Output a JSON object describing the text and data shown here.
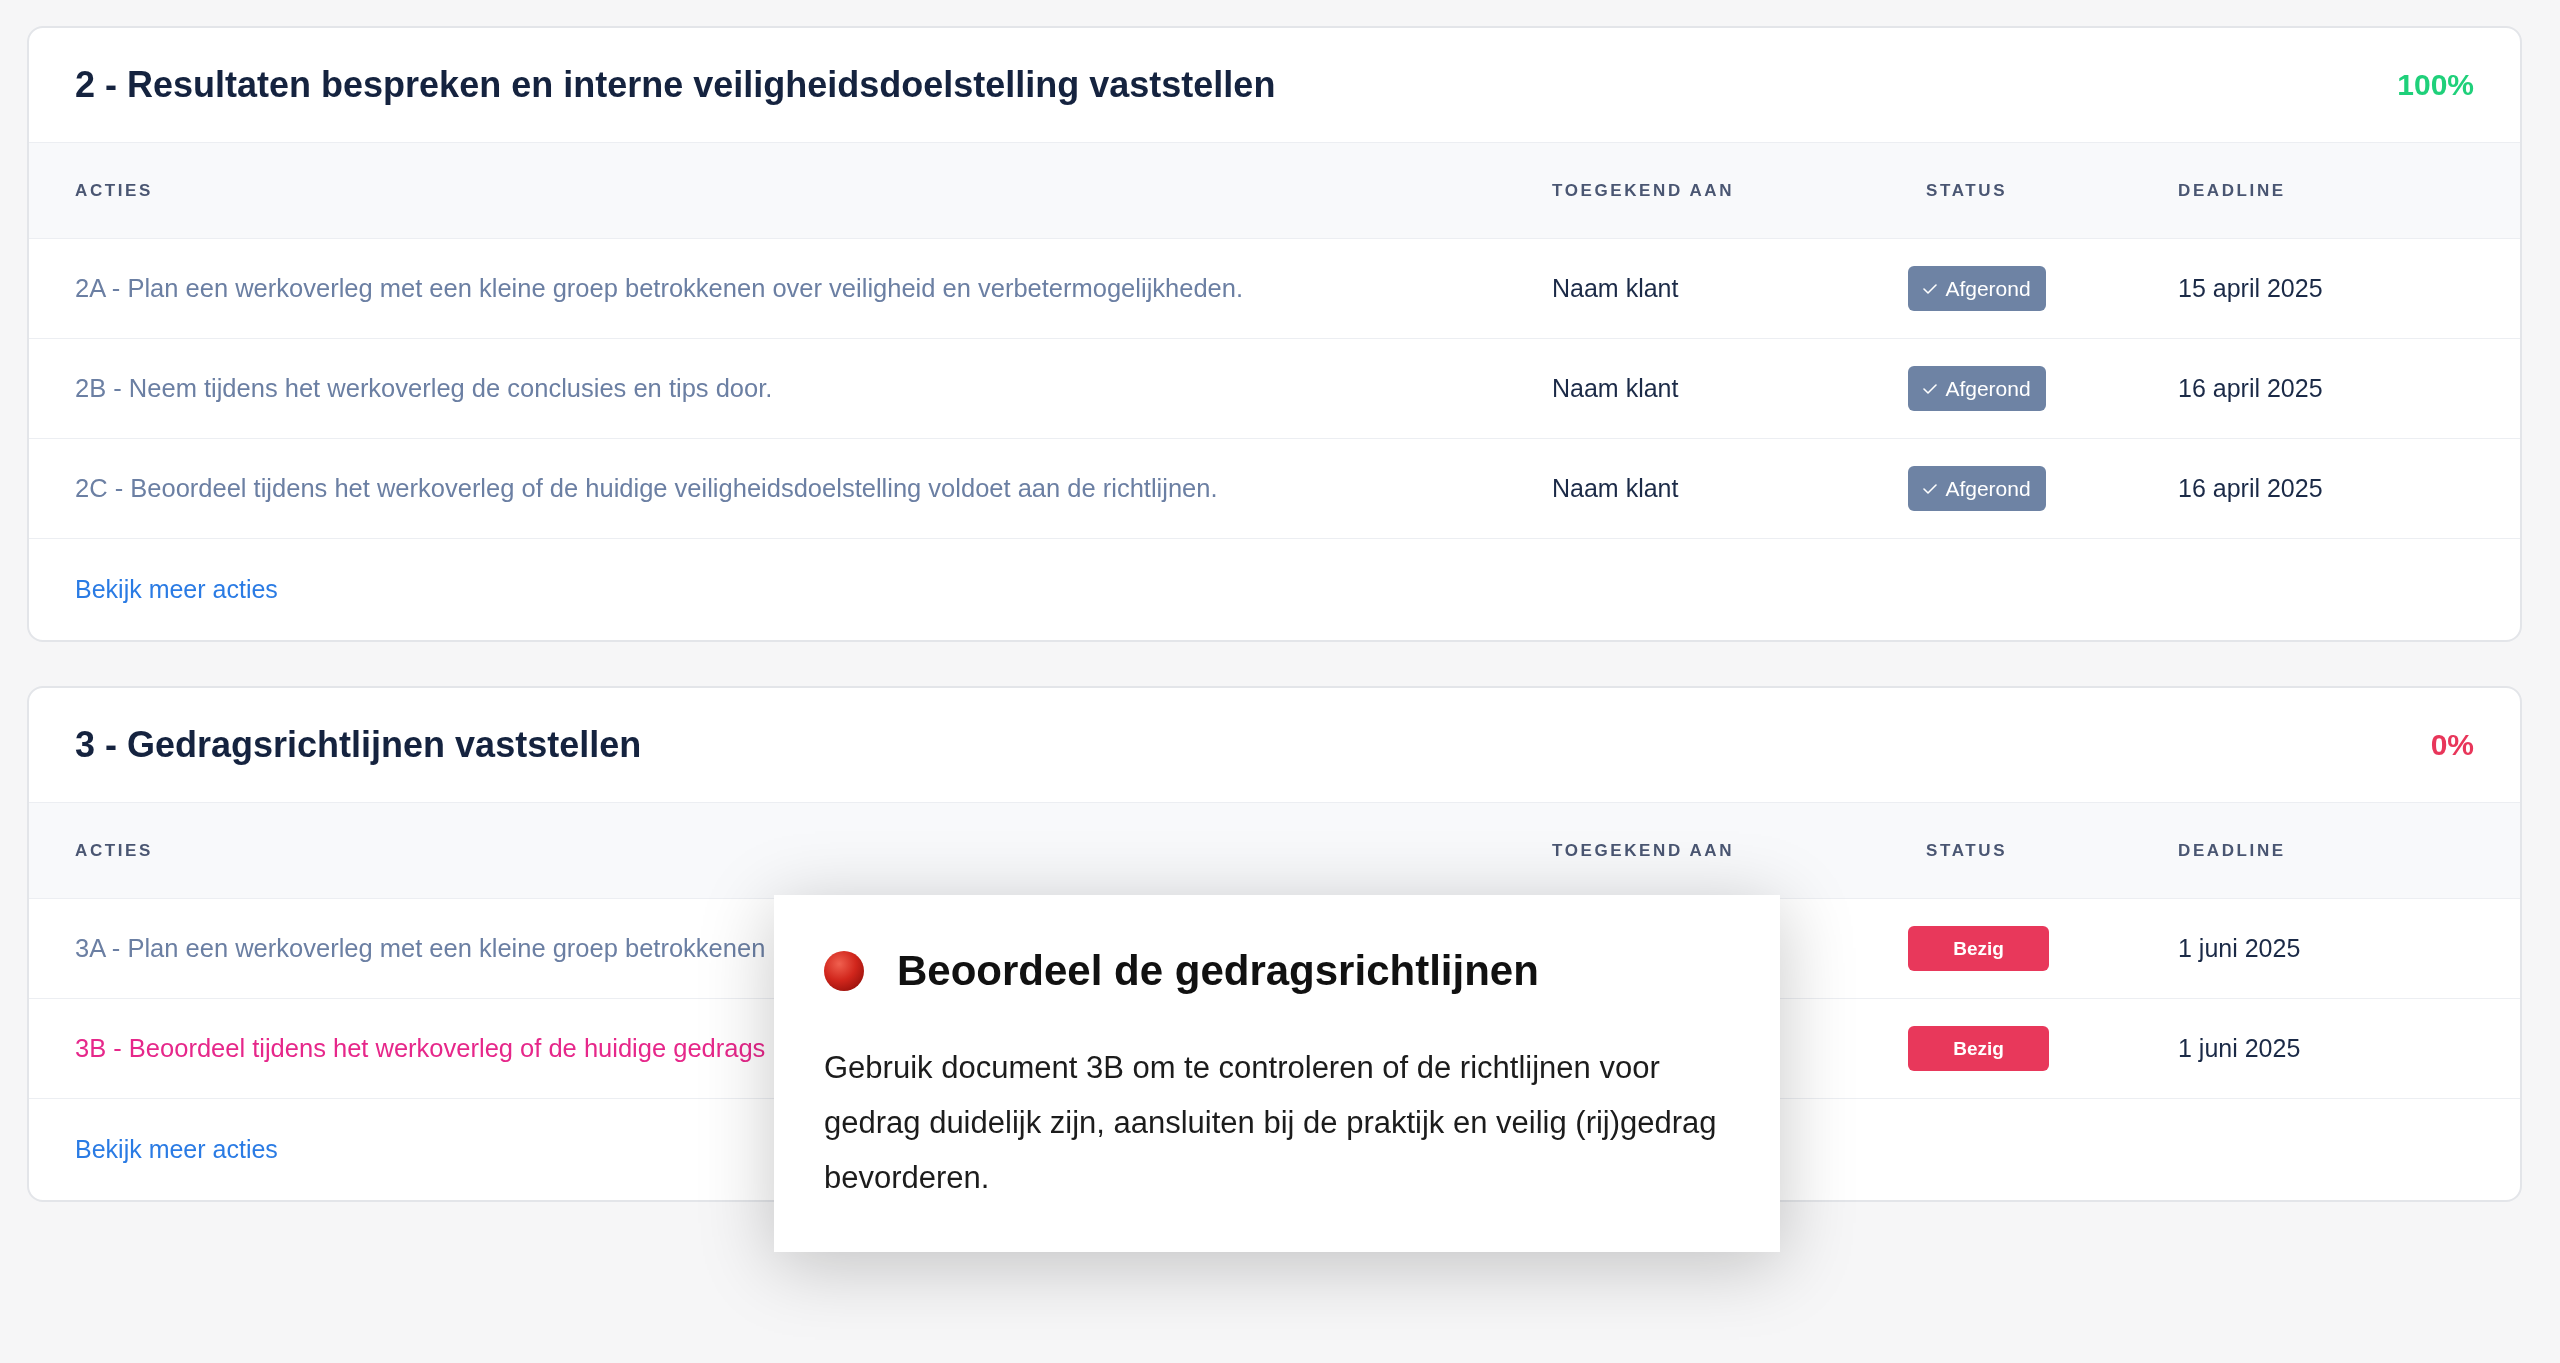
{
  "sections": [
    {
      "title": "2 - Resultaten bespreken en interne veiligheidsdoelstelling vaststellen",
      "progress": "100%",
      "complete": true,
      "columns": [
        "ACTIES",
        "TOEGEKEND AAN",
        "STATUS",
        "DEADLINE"
      ],
      "rows": [
        {
          "action": "2A - Plan een werkoverleg met een kleine groep betrokkenen over veiligheid en verbetermogelijkheden.",
          "selected": false,
          "assignee": "Naam klant",
          "status": {
            "kind": "done",
            "label": "Afgerond"
          },
          "deadline": "15 april 2025"
        },
        {
          "action": "2B - Neem tijdens het werkoverleg de conclusies en tips door.",
          "selected": false,
          "assignee": "Naam klant",
          "status": {
            "kind": "done",
            "label": "Afgerond"
          },
          "deadline": "16 april 2025"
        },
        {
          "action": "2C - Beoordeel tijdens het werkoverleg of de huidige veiligheidsdoelstelling voldoet aan de richtlijnen.",
          "selected": false,
          "assignee": "Naam klant",
          "status": {
            "kind": "done",
            "label": "Afgerond"
          },
          "deadline": "16 april 2025"
        }
      ],
      "more_link": "Bekijk meer acties"
    },
    {
      "title": "3 - Gedragsrichtlijnen vaststellen",
      "progress": "0%",
      "complete": false,
      "columns": [
        "ACTIES",
        "TOEGEKEND AAN",
        "STATUS",
        "DEADLINE"
      ],
      "rows": [
        {
          "action": "3A - Plan een werkoverleg met een kleine groep betrokkenen",
          "selected": false,
          "status": {
            "kind": "busy",
            "label": "Bezig"
          },
          "deadline": "1 juni 2025"
        },
        {
          "action": "3B - Beoordeel tijdens het werkoverleg of de huidige gedrags",
          "selected": true,
          "status": {
            "kind": "busy",
            "label": "Bezig"
          },
          "deadline": "1 juni 2025"
        }
      ],
      "more_link": "Bekijk meer acties"
    }
  ],
  "popup": {
    "title": "Beoordeel de gedragsrichtlijnen",
    "body": "Gebruik document 3B om te controleren of de richtlijnen voor gedrag duidelijk zijn, aansluiten bij de praktijk en veilig (rij)gedrag bevorderen."
  }
}
